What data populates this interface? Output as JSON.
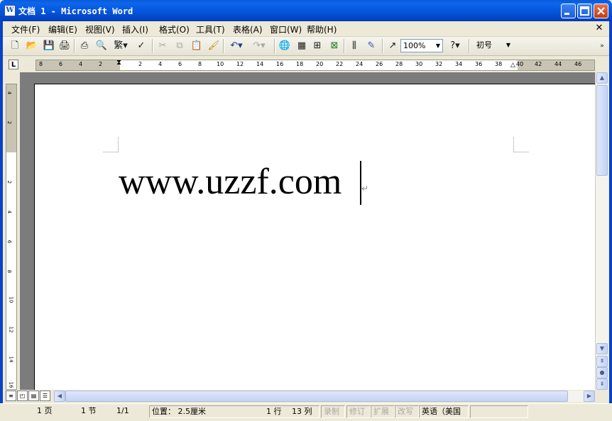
{
  "window": {
    "title": "文档 1 - Microsoft Word",
    "app_icon": "word-document-icon"
  },
  "menubar": {
    "items": [
      "文件(F)",
      "编辑(E)",
      "视图(V)",
      "插入(I)",
      "格式(O)",
      "工具(T)",
      "表格(A)",
      "窗口(W)",
      "帮助(H)"
    ]
  },
  "toolbar": {
    "zoom": "100%",
    "font_size": "初号"
  },
  "ruler": {
    "h_labels": [
      "8",
      "6",
      "4",
      "2",
      "2",
      "4",
      "6",
      "8",
      "10",
      "12",
      "14",
      "16",
      "18",
      "20",
      "22",
      "24",
      "26",
      "28",
      "30",
      "32",
      "34",
      "36",
      "38",
      "40",
      "42",
      "44",
      "46"
    ],
    "v_labels": [
      "4",
      "2",
      "2",
      "4",
      "6",
      "8",
      "10",
      "12",
      "14",
      "16"
    ]
  },
  "document": {
    "text": "www.uzzf.com"
  },
  "statusbar": {
    "page": "1 页",
    "section": "1 节",
    "page_of": "1/1",
    "position": "位置： 2.5厘米",
    "line": "1 行",
    "column": "13 列",
    "rec": "录制",
    "trk": "修订",
    "ext": "扩展",
    "ovr": "改写",
    "language": "英语（美国"
  }
}
